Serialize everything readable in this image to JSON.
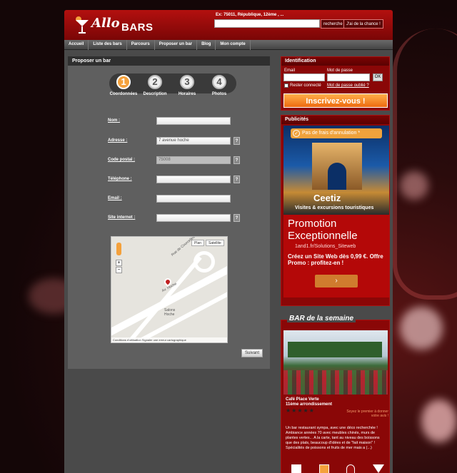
{
  "header": {
    "logo_allo": "Allo",
    "logo_bars": "BARS",
    "search_hint": "Ex: 75011, République, 12ème , ...",
    "search_button": "recherche",
    "lucky_button": "J'ai de la chance !"
  },
  "nav": {
    "items": [
      {
        "label": "Accueil"
      },
      {
        "label": "Liste des bars"
      },
      {
        "label": "Parcours"
      },
      {
        "label": "Proposer un bar"
      },
      {
        "label": "Blog"
      },
      {
        "label": "Mon compte"
      }
    ]
  },
  "form": {
    "title": "Proposer un bar",
    "steps": [
      {
        "number": "1",
        "label": "Coordonnées"
      },
      {
        "number": "2",
        "label": "Description"
      },
      {
        "number": "3",
        "label": "Horaires"
      },
      {
        "number": "4",
        "label": "Photos"
      }
    ],
    "fields": {
      "nom": {
        "label": "Nom :",
        "value": ""
      },
      "adresse": {
        "label": "Adresse :",
        "value": "7 avenue hoche"
      },
      "code_postal": {
        "label": "Code postal :",
        "value": "75008"
      },
      "telephone": {
        "label": "Téléphone :",
        "value": ""
      },
      "email": {
        "label": "Email :",
        "value": ""
      },
      "site": {
        "label": "Site internet :",
        "value": ""
      }
    },
    "help": "?",
    "map": {
      "plan": "Plan",
      "satellite": "Satellite",
      "footer": "Conditions d'utilisation   Signaler une erreur cartographique",
      "street1": "Av. Hoche",
      "street2": "Salons Hoche",
      "street3": "Rue de Courcelles"
    },
    "next_button": "Suivant"
  },
  "login": {
    "title": "Identification",
    "email_label": "Email",
    "password_label": "Mot de passe",
    "remember_label": "Rester connecté",
    "forgot_label": "Mot de passe oublié ?",
    "ok_button": "OK",
    "signup_button": "Inscrivez-vous !"
  },
  "ads": {
    "title": "Publicités",
    "badge": "Pas de frais d'annulation *",
    "brand": "Ceetiz",
    "brand_tagline": "Visites & excursions touristiques",
    "promo_title": "Promotion Exceptionnelle",
    "promo_url": "1and1.fr/Solutions_Siteweb",
    "promo_text": "Créez un Site Web dès 0,99 €. Offre Promo : profitez-en !",
    "arrow": "›"
  },
  "bar_of_week": {
    "heading": "BAR de la semaine",
    "name": "Café Place Verte",
    "district": "11ème arrondissement",
    "review_prompt": "Soyez le premier à donner votre avis !",
    "description": "Un bar restaurant sympa, avec une déco recherchée ! Ambiance années 70 avec meubles chinés, murs de plantes vertes... A la carte, tant au niveau des boissons que des plats, beaucoup d'idées et de \"fait maison\" ! Spécialités de poissons et fruits de mer mais a (...)",
    "rating": 0
  },
  "colors": {
    "brand_red": "#8a0707",
    "accent_orange": "#ee6a10"
  }
}
